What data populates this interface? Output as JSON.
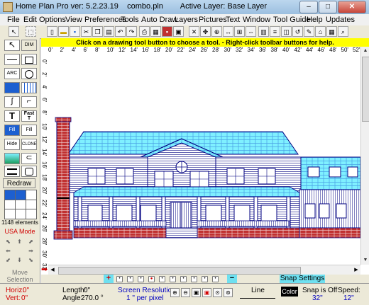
{
  "window": {
    "title": "Home Plan Pro ver: 5.2.23.19    combo.pln        Active Layer: Base Layer",
    "min_label": "–",
    "max_label": "□",
    "close_label": "✕"
  },
  "menu": [
    "File",
    "Edit",
    "Options",
    "View",
    "Preferences",
    "Tools",
    "Auto Draw",
    "Layers",
    "Pictures",
    "Text",
    "Window",
    "Tool Guide",
    "Help",
    "Updates"
  ],
  "hint": "Click on a drawing tool button to choose a tool.  -  Right-click toolbar buttons for help.",
  "toolbar_icons": [
    "pointer-icon",
    "select-box-icon",
    "new-file-icon",
    "open-folder-icon",
    "save-icon",
    "cut-icon",
    "copy-icon",
    "paste-icon",
    "undo-icon",
    "redo-icon",
    "print-icon",
    "print-preview-icon",
    "save-red-icon",
    "export-icon",
    "move-icon",
    "delete-x-icon",
    "crosshair-icon",
    "arrows-icon",
    "resize-icon",
    "mirror-icon",
    "grid-icon",
    "level-icon",
    "wall-icon",
    "layers-icon",
    "undo-arrow-icon",
    "draw-icon",
    "door-icon",
    "window-icon",
    "zoom-icon"
  ],
  "left_tools": [
    {
      "name": "select-tool",
      "label": "",
      "icon": "arrow-pointer-icon"
    },
    {
      "name": "dimension-tool",
      "label": "DIM",
      "icon": "dimension-icon"
    },
    {
      "name": "line-tool",
      "label": "",
      "icon": "line-icon"
    },
    {
      "name": "box-tool",
      "label": "",
      "icon": "square-icon"
    },
    {
      "name": "arc-tool",
      "label": "ARC",
      "icon": "arc-icon"
    },
    {
      "name": "circle-tool",
      "label": "",
      "icon": "circle-icon"
    },
    {
      "name": "fill-pattern-tool",
      "label": "",
      "icon": "fill-icon"
    },
    {
      "name": "grid-pattern-tool",
      "label": "",
      "icon": "grid-pattern-icon"
    },
    {
      "name": "curve-tool",
      "label": "",
      "icon": "curve-icon"
    },
    {
      "name": "stair-tool",
      "label": "",
      "icon": "stair-icon"
    },
    {
      "name": "text-tool",
      "label": "T",
      "icon": "text-icon"
    },
    {
      "name": "fast-text-tool",
      "label": "Fast T",
      "icon": "fast-text-icon"
    },
    {
      "name": "fill-tool",
      "label": "Fill",
      "icon": "fill-icon"
    },
    {
      "name": "fill-pattern-area-tool",
      "label": "Fill",
      "icon": "fill-pattern-icon"
    },
    {
      "name": "hide-tool",
      "label": "Hide",
      "icon": "hide-icon"
    },
    {
      "name": "clone-tool",
      "label": "CLONE",
      "icon": "clone-icon"
    },
    {
      "name": "picture-tool",
      "label": "",
      "icon": "picture-icon"
    },
    {
      "name": "lasso-tool",
      "label": "",
      "icon": "lasso-icon"
    },
    {
      "name": "wall-tool",
      "label": "",
      "icon": "wall-icon"
    },
    {
      "name": "rounded-box-tool",
      "label": "",
      "icon": "rounded-box-icon"
    }
  ],
  "redraw_label": "Redraw",
  "element_count": "1148 elements",
  "usa_mode": "USA Mode",
  "move_selection": "Move\nSelection",
  "ruler_top": [
    "0'",
    "2'",
    "4'",
    "6'",
    "8'",
    "10'",
    "12'",
    "14'",
    "16'",
    "18'",
    "20'",
    "22'",
    "24'",
    "26'",
    "28'",
    "30'",
    "32'",
    "34'",
    "36'",
    "38'",
    "40'",
    "42'",
    "44'",
    "46'",
    "48'",
    "50'",
    "52'"
  ],
  "ruler_left": [
    "0'",
    "2'",
    "4'",
    "6'",
    "8'",
    "10'",
    "12'",
    "14'",
    "16'",
    "18'",
    "20'",
    "22'",
    "24'",
    "26'",
    "28'",
    "30'",
    "32'"
  ],
  "layer_bar": {
    "snap_settings": "Snap Settings",
    "add_label": "+",
    "remove_label": "−"
  },
  "status": {
    "horiz_label": "Horiz:",
    "horiz_value": "0\"",
    "vert_label": "Vert:",
    "vert_value": "0\"",
    "length_label": "Length:",
    "length_value": "0\"",
    "angle_label": "Angle:",
    "angle_value": "270.0 °",
    "screen_res_label": "Screen Resolution",
    "screen_res_value": "1 \" per pixel",
    "line_label": "Line",
    "color_label": "Color",
    "snap_label": "Snap is Off",
    "snap_value": "32\"",
    "speed_label": "Speed:",
    "speed_value": "12\""
  },
  "colors": {
    "roof": "#7ff0ff",
    "line": "#000080",
    "brick": "#c03030",
    "hint": "#ffff00",
    "accent": "#0000c0"
  }
}
